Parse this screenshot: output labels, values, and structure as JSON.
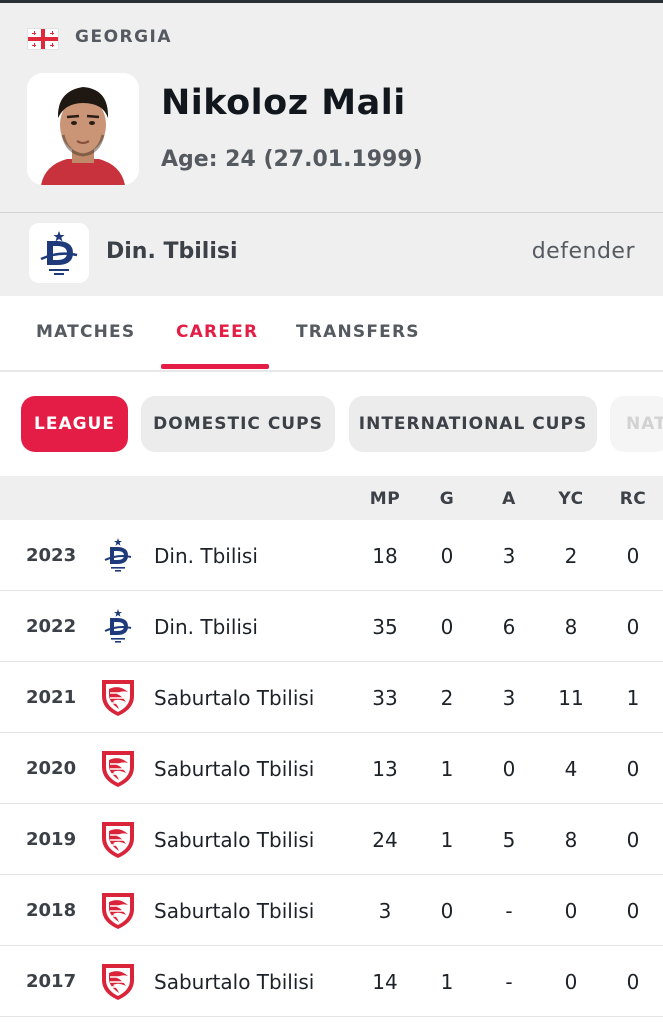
{
  "player": {
    "country": "GEORGIA",
    "name": "Nikoloz Mali",
    "age_label": "Age:",
    "age_value": "24 (27.01.1999)",
    "team": "Din. Tbilisi",
    "position": "defender"
  },
  "tabs": [
    {
      "label": "MATCHES",
      "active": false
    },
    {
      "label": "CAREER",
      "active": true
    },
    {
      "label": "TRANSFERS",
      "active": false
    }
  ],
  "filters": [
    {
      "label": "LEAGUE",
      "active": true
    },
    {
      "label": "DOMESTIC CUPS",
      "active": false
    },
    {
      "label": "INTERNATIONAL CUPS",
      "active": false
    },
    {
      "label": "NAT",
      "active": false
    }
  ],
  "table": {
    "columns": [
      "MP",
      "G",
      "A",
      "YC",
      "RC"
    ],
    "rows": [
      {
        "year": "2023",
        "club": "Din. Tbilisi",
        "logo": "dinamo-logo-icon",
        "mp": "18",
        "g": "0",
        "a": "3",
        "yc": "2",
        "rc": "0"
      },
      {
        "year": "2022",
        "club": "Din. Tbilisi",
        "logo": "dinamo-logo-icon",
        "mp": "35",
        "g": "0",
        "a": "6",
        "yc": "8",
        "rc": "0"
      },
      {
        "year": "2021",
        "club": "Saburtalo Tbilisi",
        "logo": "saburtalo-logo-icon",
        "mp": "33",
        "g": "2",
        "a": "3",
        "yc": "11",
        "rc": "1"
      },
      {
        "year": "2020",
        "club": "Saburtalo Tbilisi",
        "logo": "saburtalo-logo-icon",
        "mp": "13",
        "g": "1",
        "a": "0",
        "yc": "4",
        "rc": "0"
      },
      {
        "year": "2019",
        "club": "Saburtalo Tbilisi",
        "logo": "saburtalo-logo-icon",
        "mp": "24",
        "g": "1",
        "a": "5",
        "yc": "8",
        "rc": "0"
      },
      {
        "year": "2018",
        "club": "Saburtalo Tbilisi",
        "logo": "saburtalo-logo-icon",
        "mp": "3",
        "g": "0",
        "a": "-",
        "yc": "0",
        "rc": "0"
      },
      {
        "year": "2017",
        "club": "Saburtalo Tbilisi",
        "logo": "saburtalo-logo-icon",
        "mp": "14",
        "g": "1",
        "a": "-",
        "yc": "0",
        "rc": "0"
      }
    ]
  },
  "colors": {
    "accent": "#e41d46",
    "dinamo_blue": "#1f3a7a",
    "saburtalo_red": "#d9243a"
  }
}
